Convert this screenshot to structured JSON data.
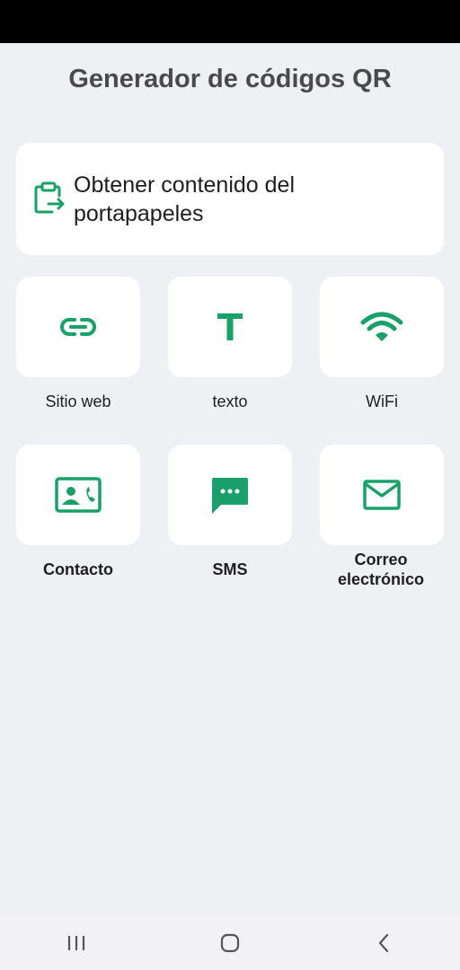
{
  "app": {
    "title": "Generador de códigos QR"
  },
  "clipboard": {
    "label": "Obtener contenido del portapapeles",
    "icon": "clipboard-import-icon"
  },
  "tiles": [
    {
      "label": "Sitio web",
      "icon": "link-icon"
    },
    {
      "label": "texto",
      "icon": "text-icon"
    },
    {
      "label": "WiFi",
      "icon": "wifi-icon"
    },
    {
      "label": "Contacto",
      "icon": "contact-card-icon"
    },
    {
      "label": "SMS",
      "icon": "sms-icon"
    },
    {
      "label": "Correo electrónico",
      "icon": "mail-icon"
    }
  ],
  "nav": {
    "recents_icon": "recents-icon",
    "home_icon": "home-icon",
    "back_icon": "back-icon"
  },
  "colors": {
    "accent": "#1aa069",
    "background": "#eff0f4",
    "card": "#ffffff"
  }
}
